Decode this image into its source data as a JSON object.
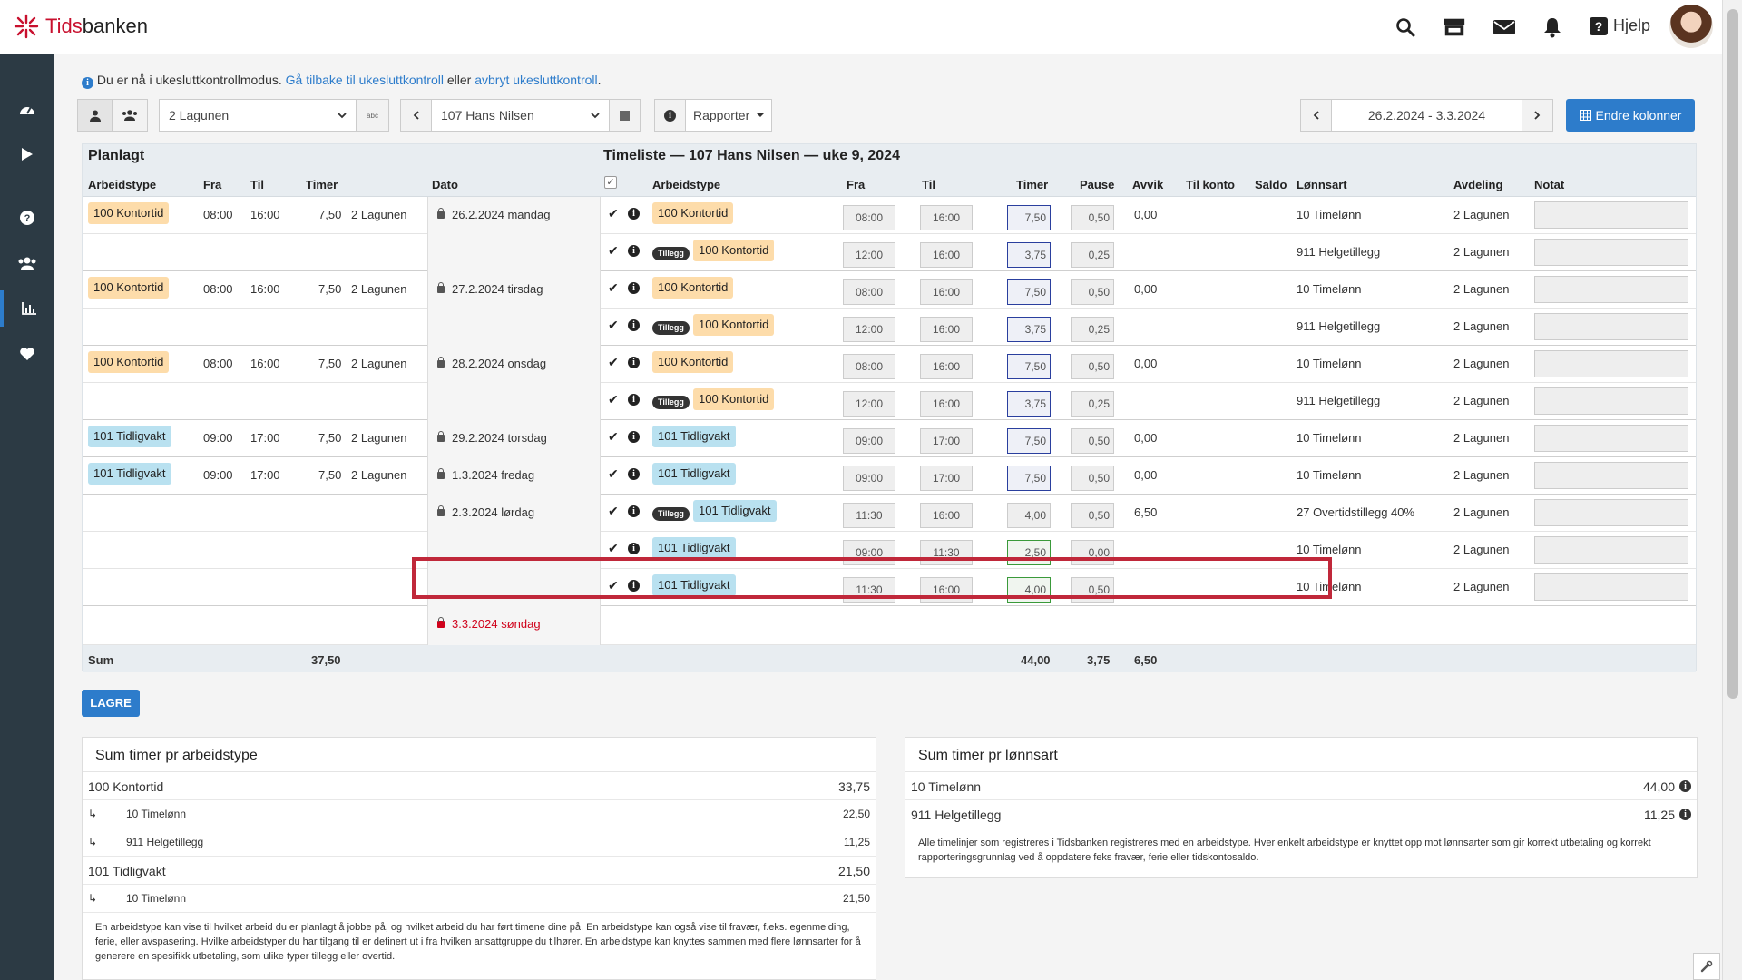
{
  "app": {
    "logo_pre": "Tids",
    "logo_post": "banken",
    "help": "Hjelp"
  },
  "notice": {
    "text": "Du er nå i ukesluttkontrollmodus.",
    "link1": "Gå tilbake til ukesluttkontroll",
    "mid": "eller",
    "link2": "avbryt ukesluttkontroll",
    "end": "."
  },
  "toolbar": {
    "dept": "2 Lagunen",
    "employee": "107 Hans Nilsen",
    "reports": "Rapporter",
    "period": "26.2.2024 - 3.3.2024",
    "edit_columns": "Endre kolonner",
    "letters": "abc"
  },
  "table": {
    "planned_title": "Planlagt",
    "timesheet_title": "Timeliste — 107 Hans Nilsen — uke 9, 2024",
    "cols_left": {
      "arbeidstype": "Arbeidstype",
      "fra": "Fra",
      "til": "Til",
      "timer": "Timer",
      "dato": "Dato"
    },
    "cols_right": {
      "arbeidstype": "Arbeidstype",
      "fra": "Fra",
      "til": "Til",
      "timer": "Timer",
      "pause": "Pause",
      "avvik": "Avvik",
      "til_konto": "Til konto",
      "saldo": "Saldo",
      "lonnsart": "Lønnsart",
      "avdeling": "Avdeling",
      "notat": "Notat"
    },
    "tillegg_label": "Tillegg",
    "rows": [
      {
        "p_type": "100 Kontortid",
        "p_kind": "k",
        "p_fra": "08:00",
        "p_til": "16:00",
        "p_timer": "7,50",
        "p_avd": "2 Lagunen",
        "dato": "26.2.2024 mandag",
        "tillegg": false,
        "type": "100 Kontortid",
        "kind": "k",
        "fra": "08:00",
        "til": "16:00",
        "timer": "7,50",
        "pause": "0,50",
        "avvik": "0,00",
        "lonnsart": "10 Timelønn",
        "avd": "2 Lagunen",
        "tbox": "tim"
      },
      {
        "p_type": "",
        "p_kind": "",
        "p_fra": "",
        "p_til": "",
        "p_timer": "",
        "p_avd": "",
        "dato": "",
        "tillegg": true,
        "type": "100 Kontortid",
        "kind": "k",
        "fra": "12:00",
        "til": "16:00",
        "timer": "3,75",
        "pause": "0,25",
        "avvik": "",
        "lonnsart": "911 Helgetillegg",
        "avd": "2 Lagunen",
        "tbox": "tim"
      },
      {
        "p_type": "100 Kontortid",
        "p_kind": "k",
        "p_fra": "08:00",
        "p_til": "16:00",
        "p_timer": "7,50",
        "p_avd": "2 Lagunen",
        "dato": "27.2.2024 tirsdag",
        "tillegg": false,
        "type": "100 Kontortid",
        "kind": "k",
        "fra": "08:00",
        "til": "16:00",
        "timer": "7,50",
        "pause": "0,50",
        "avvik": "0,00",
        "lonnsart": "10 Timelønn",
        "avd": "2 Lagunen",
        "tbox": "tim"
      },
      {
        "p_type": "",
        "p_kind": "",
        "p_fra": "",
        "p_til": "",
        "p_timer": "",
        "p_avd": "",
        "dato": "",
        "tillegg": true,
        "type": "100 Kontortid",
        "kind": "k",
        "fra": "12:00",
        "til": "16:00",
        "timer": "3,75",
        "pause": "0,25",
        "avvik": "",
        "lonnsart": "911 Helgetillegg",
        "avd": "2 Lagunen",
        "tbox": "tim"
      },
      {
        "p_type": "100 Kontortid",
        "p_kind": "k",
        "p_fra": "08:00",
        "p_til": "16:00",
        "p_timer": "7,50",
        "p_avd": "2 Lagunen",
        "dato": "28.2.2024 onsdag",
        "tillegg": false,
        "type": "100 Kontortid",
        "kind": "k",
        "fra": "08:00",
        "til": "16:00",
        "timer": "7,50",
        "pause": "0,50",
        "avvik": "0,00",
        "lonnsart": "10 Timelønn",
        "avd": "2 Lagunen",
        "tbox": "tim"
      },
      {
        "p_type": "",
        "p_kind": "",
        "p_fra": "",
        "p_til": "",
        "p_timer": "",
        "p_avd": "",
        "dato": "",
        "tillegg": true,
        "type": "100 Kontortid",
        "kind": "k",
        "fra": "12:00",
        "til": "16:00",
        "timer": "3,75",
        "pause": "0,25",
        "avvik": "",
        "lonnsart": "911 Helgetillegg",
        "avd": "2 Lagunen",
        "tbox": "tim"
      },
      {
        "p_type": "101 Tidligvakt",
        "p_kind": "t",
        "p_fra": "09:00",
        "p_til": "17:00",
        "p_timer": "7,50",
        "p_avd": "2 Lagunen",
        "dato": "29.2.2024 torsdag",
        "tillegg": false,
        "type": "101 Tidligvakt",
        "kind": "t",
        "fra": "09:00",
        "til": "17:00",
        "timer": "7,50",
        "pause": "0,50",
        "avvik": "0,00",
        "lonnsart": "10 Timelønn",
        "avd": "2 Lagunen",
        "tbox": "tim"
      },
      {
        "p_type": "101 Tidligvakt",
        "p_kind": "t",
        "p_fra": "09:00",
        "p_til": "17:00",
        "p_timer": "7,50",
        "p_avd": "2 Lagunen",
        "dato": "1.3.2024 fredag",
        "tillegg": false,
        "type": "101 Tidligvakt",
        "kind": "t",
        "fra": "09:00",
        "til": "17:00",
        "timer": "7,50",
        "pause": "0,50",
        "avvik": "0,00",
        "lonnsart": "10 Timelønn",
        "avd": "2 Lagunen",
        "tbox": "tim"
      },
      {
        "p_type": "",
        "p_kind": "",
        "p_fra": "",
        "p_til": "",
        "p_timer": "",
        "p_avd": "",
        "dato": "2.3.2024 lørdag",
        "tillegg": true,
        "type": "101 Tidligvakt",
        "kind": "t",
        "fra": "11:30",
        "til": "16:00",
        "timer": "4,00",
        "pause": "0,50",
        "avvik": "6,50",
        "lonnsart": "27 Overtidstillegg 40%",
        "avd": "2 Lagunen",
        "tbox": "red"
      },
      {
        "p_type": "",
        "p_kind": "",
        "p_fra": "",
        "p_til": "",
        "p_timer": "",
        "p_avd": "",
        "dato": "",
        "tillegg": false,
        "type": "101 Tidligvakt",
        "kind": "t",
        "fra": "09:00",
        "til": "11:30",
        "timer": "2,50",
        "pause": "0,00",
        "avvik": "",
        "lonnsart": "10 Timelønn",
        "avd": "2 Lagunen",
        "tbox": "grn"
      },
      {
        "p_type": "",
        "p_kind": "",
        "p_fra": "",
        "p_til": "",
        "p_timer": "",
        "p_avd": "",
        "dato": "",
        "tillegg": false,
        "type": "101 Tidligvakt",
        "kind": "t",
        "fra": "11:30",
        "til": "16:00",
        "timer": "4,00",
        "pause": "0,50",
        "avvik": "",
        "lonnsart": "10 Timelønn",
        "avd": "2 Lagunen",
        "tbox": "grn"
      }
    ],
    "sunday": "3.3.2024 søndag",
    "sum": {
      "label": "Sum",
      "planned": "37,50",
      "timer": "44,00",
      "pause": "3,75",
      "avvik": "6,50"
    }
  },
  "save": "LAGRE",
  "panel_type": {
    "title": "Sum timer pr arbeidstype",
    "rows": [
      {
        "label": "100 Kontortid",
        "value": "33,75",
        "sub": false
      },
      {
        "label": "10 Timelønn",
        "value": "22,50",
        "sub": true
      },
      {
        "label": "911 Helgetillegg",
        "value": "11,25",
        "sub": true
      },
      {
        "label": "101 Tidligvakt",
        "value": "21,50",
        "sub": false
      },
      {
        "label": "10 Timelønn",
        "value": "21,50",
        "sub": true
      }
    ],
    "note": "En arbeidstype kan vise til hvilket arbeid du er planlagt å jobbe på, og hvilket arbeid du har ført timene dine på. En arbeidstype kan også vise til fravær, f.eks. egenmelding, ferie, eller avspasering. Hvilke arbeidstyper du har tilgang til er definert ut i fra hvilken ansattgruppe du tilhører. En arbeidstype kan knyttes sammen med flere lønnsarter for å generere en spesifikk utbetaling, som ulike typer tillegg eller overtid."
  },
  "panel_wage": {
    "title": "Sum timer pr lønnsart",
    "rows": [
      {
        "label": "10 Timelønn",
        "value": "44,00"
      },
      {
        "label": "911 Helgetillegg",
        "value": "11,25"
      }
    ],
    "note": "Alle timelinjer som registreres i Tidsbanken registreres med en arbeidstype. Hver enkelt arbeidstype er knyttet opp mot lønnsarter som gir korrekt utbetaling og korrekt rapporteringsgrunnlag ved å oppdatere feks fravær, ferie eller tidskontosaldo."
  },
  "colors": {
    "accent": "#2d7ccb",
    "sidebar": "#2c3a44",
    "kontortid": "#fddcaa",
    "tidligvakt": "#b9e1f0",
    "highlight": "#c0283a"
  },
  "icons": [
    "search-icon",
    "store-icon",
    "mail-icon",
    "bell-icon",
    "dashboard-icon",
    "play-icon",
    "help-icon",
    "users-icon",
    "chart-icon",
    "heart-icon"
  ]
}
